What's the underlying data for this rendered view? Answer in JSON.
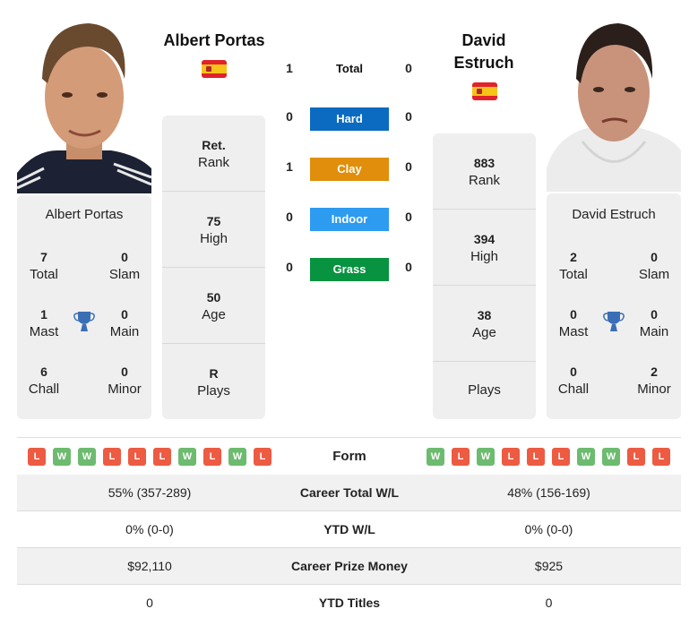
{
  "colors": {
    "hard": "#0a6bc1",
    "clay": "#e08e0b",
    "indoor": "#2d9bf0",
    "grass": "#079340",
    "win": "#6dbb6f",
    "loss": "#ec5b42",
    "trophy": "#3a6fb5",
    "card_bg": "#efefef"
  },
  "left_player": {
    "name": "Albert Portas",
    "country_flag": "spain-flag",
    "card_name": "Albert Portas",
    "titles": [
      {
        "value": "7",
        "label": "Total"
      },
      {
        "value": "0",
        "label": "Slam"
      },
      {
        "value": "1",
        "label": "Mast"
      },
      {
        "value": "0",
        "label": "Main"
      },
      {
        "value": "6",
        "label": "Chall"
      },
      {
        "value": "0",
        "label": "Minor"
      }
    ],
    "info": [
      {
        "value": "Ret.",
        "label": "Rank"
      },
      {
        "value": "75",
        "label": "High"
      },
      {
        "value": "50",
        "label": "Age"
      },
      {
        "value": "R",
        "label": "Plays"
      }
    ],
    "form": [
      "L",
      "W",
      "W",
      "L",
      "L",
      "L",
      "W",
      "L",
      "W",
      "L"
    ]
  },
  "right_player": {
    "name": "David Estruch",
    "name_line1": "David",
    "name_line2": "Estruch",
    "country_flag": "spain-flag",
    "card_name": "David Estruch",
    "titles": [
      {
        "value": "2",
        "label": "Total"
      },
      {
        "value": "0",
        "label": "Slam"
      },
      {
        "value": "0",
        "label": "Mast"
      },
      {
        "value": "0",
        "label": "Main"
      },
      {
        "value": "0",
        "label": "Chall"
      },
      {
        "value": "2",
        "label": "Minor"
      }
    ],
    "info": [
      {
        "value": "883",
        "label": "Rank"
      },
      {
        "value": "394",
        "label": "High"
      },
      {
        "value": "38",
        "label": "Age"
      },
      {
        "value": "",
        "label": "Plays"
      }
    ],
    "form": [
      "W",
      "L",
      "W",
      "L",
      "L",
      "L",
      "W",
      "W",
      "L",
      "L"
    ]
  },
  "h2h": [
    {
      "label": "Total",
      "left": "1",
      "right": "0"
    },
    {
      "label": "Hard",
      "left": "0",
      "right": "0"
    },
    {
      "label": "Clay",
      "left": "1",
      "right": "0"
    },
    {
      "label": "Indoor",
      "left": "0",
      "right": "0"
    },
    {
      "label": "Grass",
      "left": "0",
      "right": "0"
    }
  ],
  "form_label": "Form",
  "comparison": [
    {
      "label": "Career Total W/L",
      "left": "55% (357-289)",
      "right": "48% (156-169)"
    },
    {
      "label": "YTD W/L",
      "left": "0% (0-0)",
      "right": "0% (0-0)"
    },
    {
      "label": "Career Prize Money",
      "left": "$92,110",
      "right": "$925"
    },
    {
      "label": "YTD Titles",
      "left": "0",
      "right": "0"
    }
  ]
}
